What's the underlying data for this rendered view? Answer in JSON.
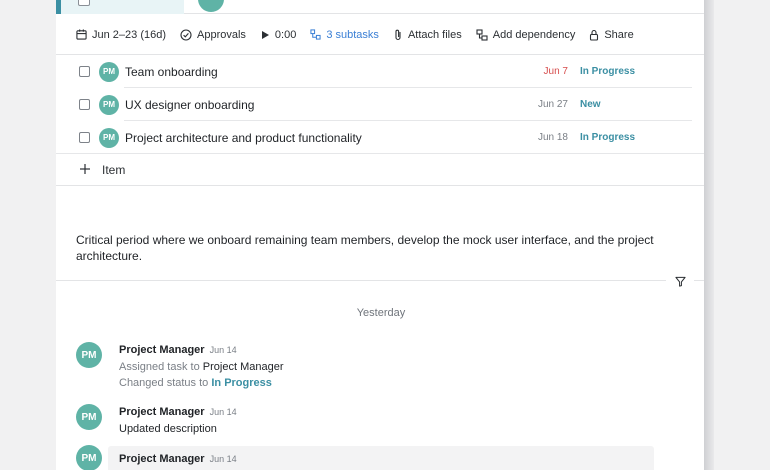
{
  "toolbar": {
    "date_range": "Jun 2–23 (16d)",
    "approvals": "Approvals",
    "timer": "0:00",
    "subtasks": "3 subtasks",
    "attach": "Attach files",
    "dependency": "Add dependency",
    "share": "Share"
  },
  "subtasks": [
    {
      "avatar": "PM",
      "title": "Team onboarding",
      "date": "Jun 7",
      "overdue": true,
      "status": "In Progress"
    },
    {
      "avatar": "PM",
      "title": "UX designer onboarding",
      "date": "Jun 27",
      "overdue": false,
      "status": "New"
    },
    {
      "avatar": "PM",
      "title": "Project architecture and product functionality",
      "date": "Jun 18",
      "overdue": false,
      "status": "In Progress"
    }
  ],
  "add_item_label": "Item",
  "description": "Critical period where we onboard remaining team members, develop the mock user interface, and the project architecture.",
  "activity": {
    "day_label": "Yesterday",
    "entries": [
      {
        "avatar": "PM",
        "user": "Project Manager",
        "date": "Jun 14",
        "line1_prefix": "Assigned task to",
        "line1_value": "Project Manager",
        "line2_prefix": "Changed status to",
        "line2_value": "In Progress"
      },
      {
        "avatar": "PM",
        "user": "Project Manager",
        "date": "Jun 14",
        "text": "Updated description"
      },
      {
        "avatar": "PM",
        "user": "Project Manager",
        "date": "Jun 14"
      }
    ]
  },
  "colors": {
    "accent": "#3b8fa3",
    "avatar": "#5fb3a6",
    "overdue": "#d64c4c",
    "link": "#3a7fd5"
  }
}
